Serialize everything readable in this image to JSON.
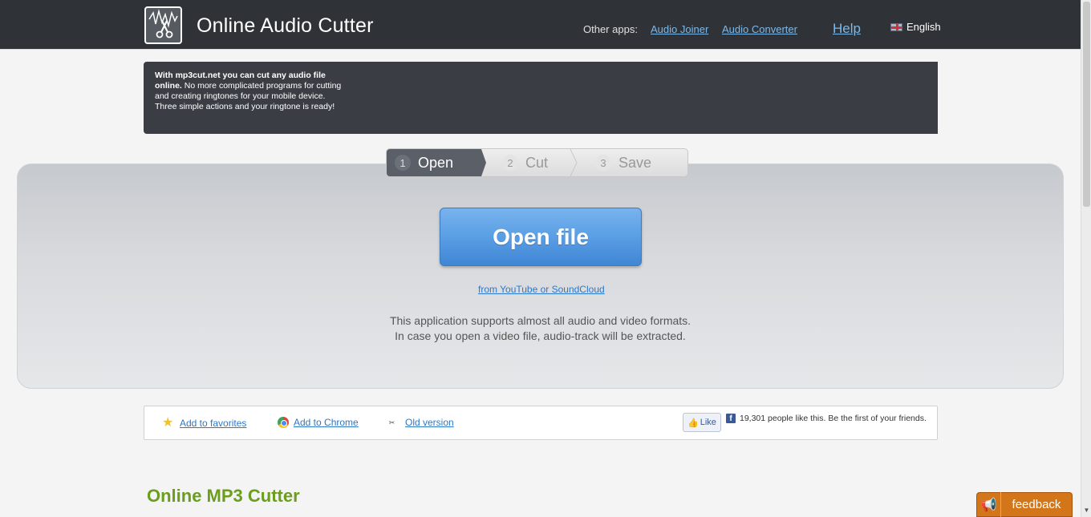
{
  "header": {
    "title": "Online Audio Cutter",
    "other_apps_label": "Other apps:",
    "links": [
      {
        "label": "Audio Joiner"
      },
      {
        "label": "Audio Converter"
      }
    ],
    "help": "Help",
    "language": "English"
  },
  "promo": {
    "bold": "With mp3cut.net you can cut any audio file online.",
    "text": " No more complicated programs for cutting and creating ringtones for your mobile device. Three simple actions and your ringtone is ready!"
  },
  "steps": [
    {
      "num": "1",
      "label": "Open",
      "active": true
    },
    {
      "num": "2",
      "label": "Cut",
      "active": false
    },
    {
      "num": "3",
      "label": "Save",
      "active": false
    }
  ],
  "main": {
    "open_button": "Open file",
    "youtube_link": "from YouTube or SoundCloud",
    "support_line1": "This application supports almost all audio and video formats.",
    "support_line2": "In case you open a video file, audio-track will be extracted."
  },
  "bar": {
    "favorites": "Add to favorites",
    "chrome": "Add to Chrome",
    "old_version": "Old version",
    "like": "Like",
    "fb_text": "19,301 people like this. Be the first of your friends."
  },
  "section_title": "Online MP3 Cutter",
  "feedback": "feedback",
  "colors": {
    "header_bg": "#2f3338",
    "link": "#2d77c8",
    "open_button": "#5a9ee4",
    "section_title": "#6a9e1c",
    "feedback_bg": "#d3761a"
  }
}
